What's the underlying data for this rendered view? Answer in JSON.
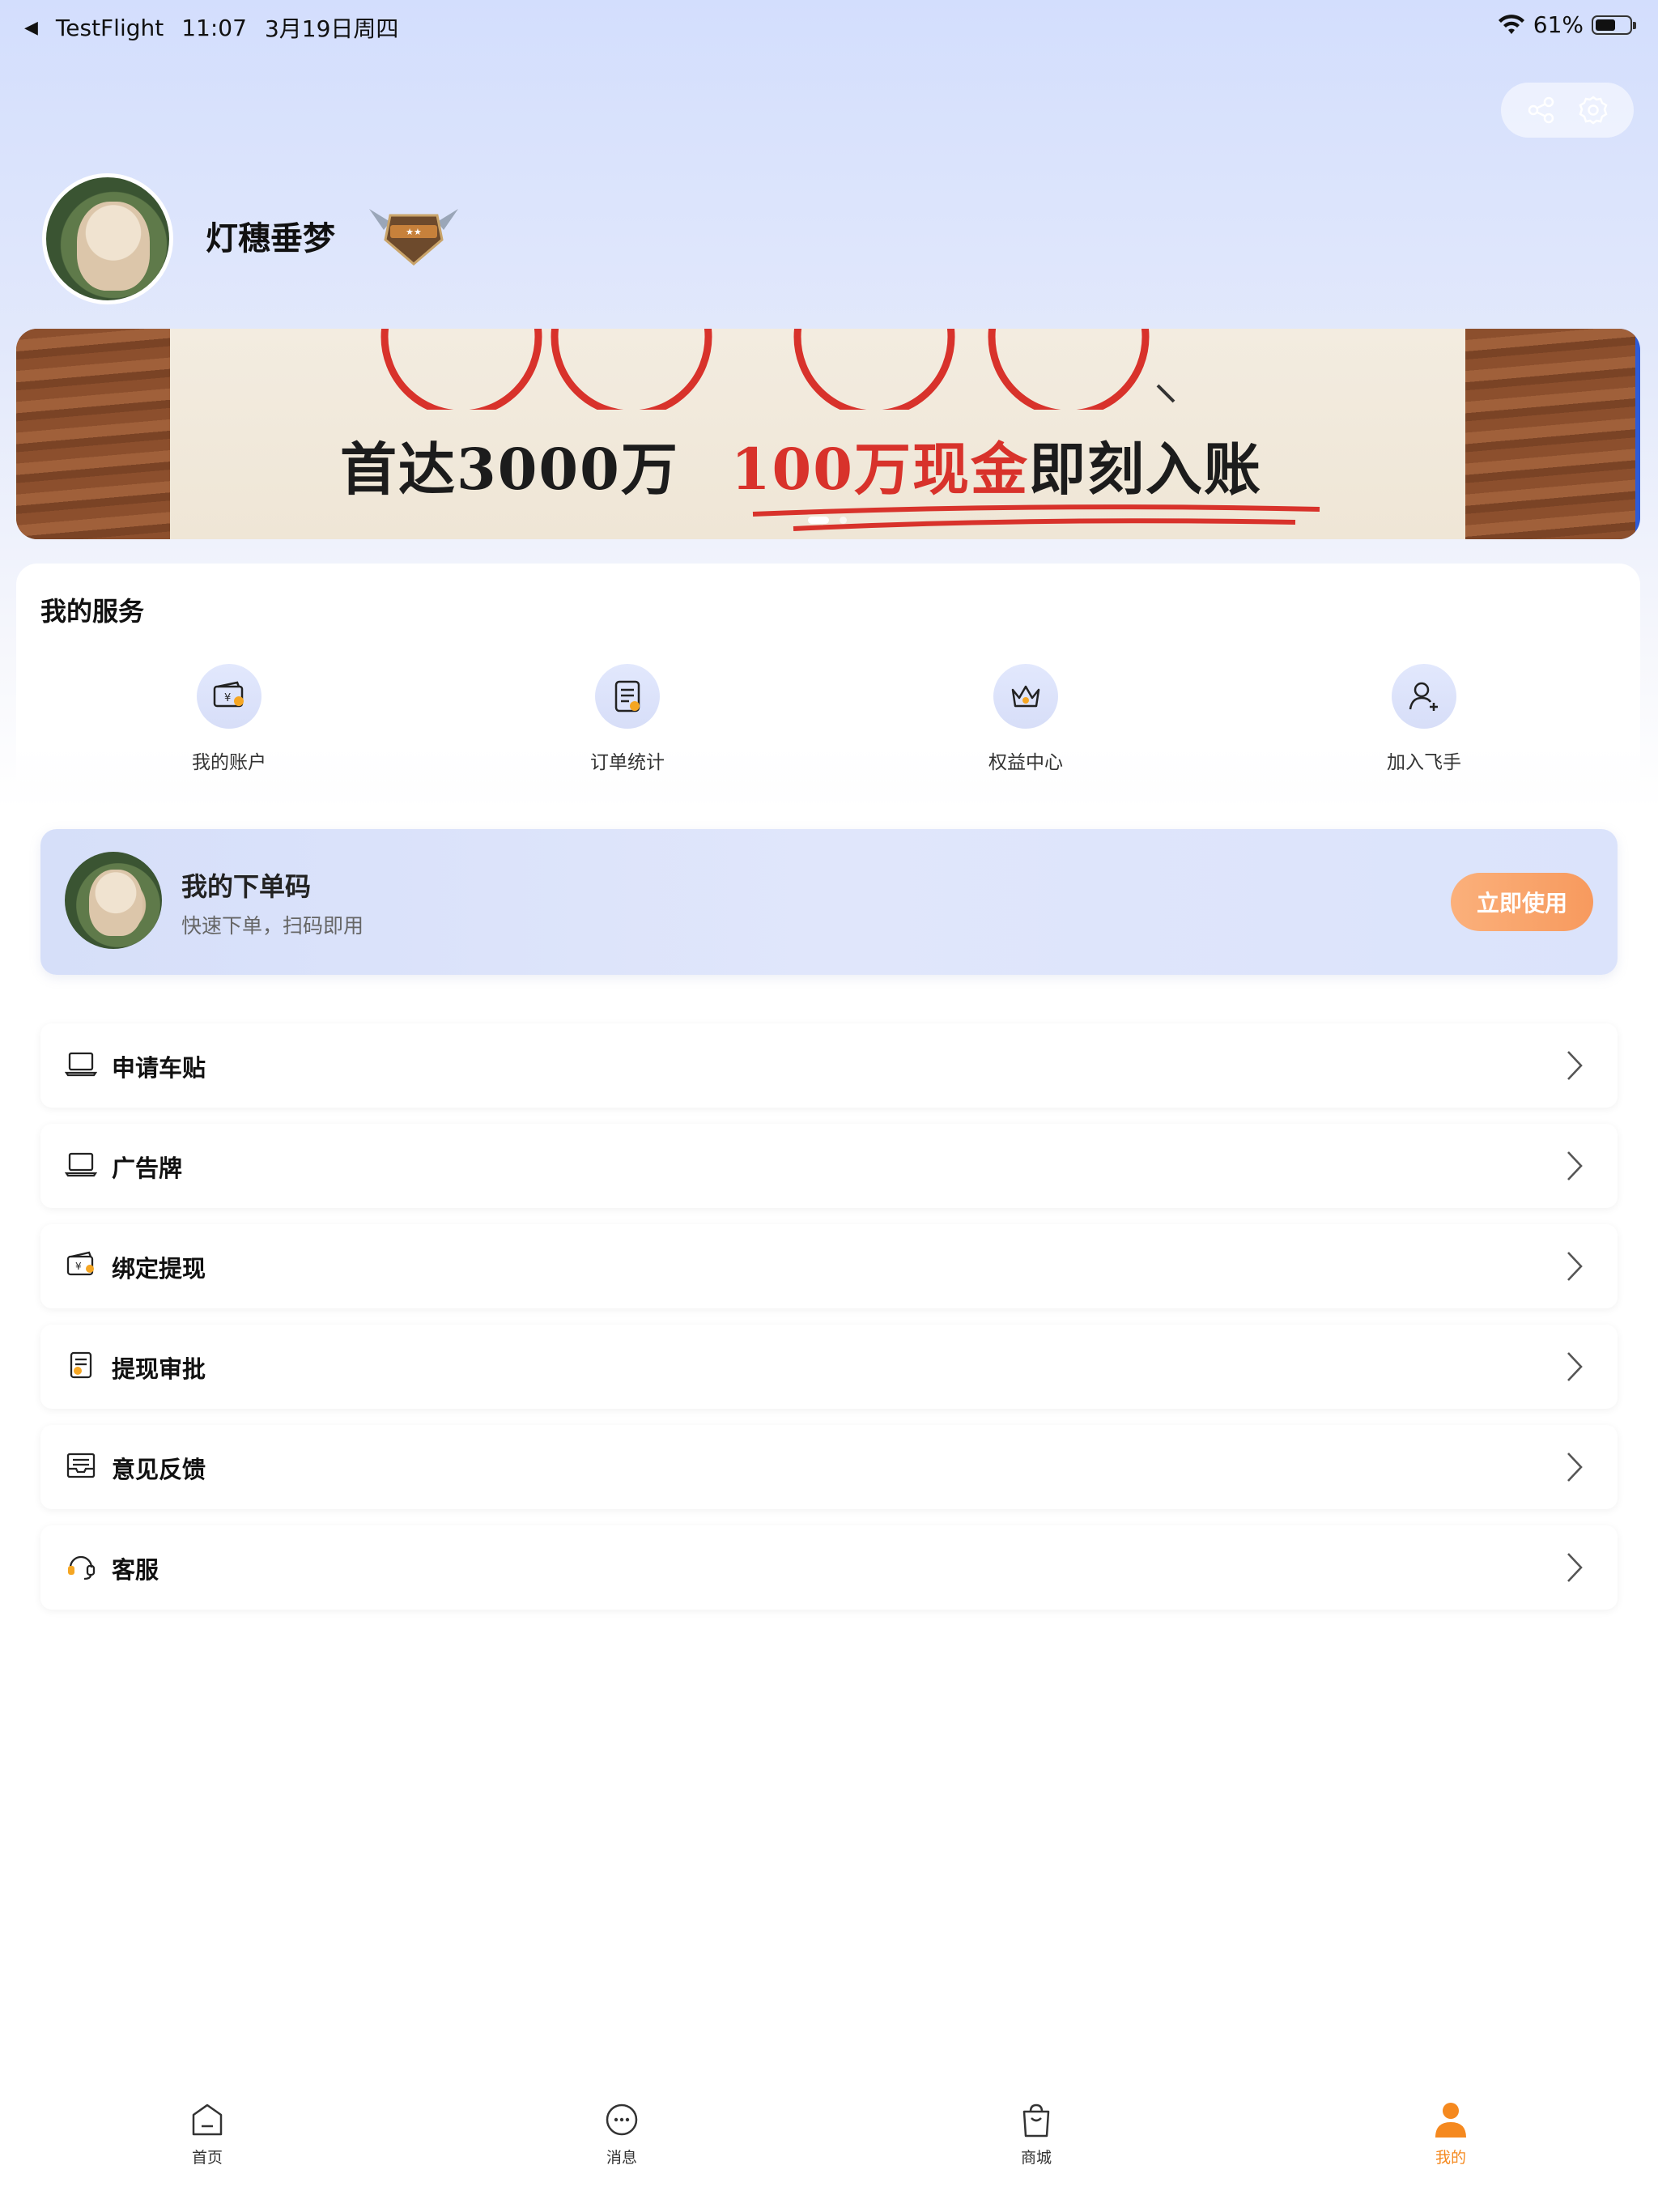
{
  "status_bar": {
    "back_app": "TestFlight",
    "time": "11:07",
    "date": "3月19日周四",
    "battery": "61%",
    "battery_level": 0.61
  },
  "profile": {
    "username": "灯穗垂梦",
    "badge_icon": "rank-badge-icon"
  },
  "banner": {
    "text_main": "首达3000万",
    "text_highlight": "100万现金",
    "text_tail": "即刻入账",
    "page_count": 2,
    "current_page": 1
  },
  "services": {
    "title": "我的服务",
    "items": [
      {
        "label": "我的账户",
        "icon": "wallet-icon"
      },
      {
        "label": "订单统计",
        "icon": "order-list-icon"
      },
      {
        "label": "权益中心",
        "icon": "crown-icon"
      },
      {
        "label": "加入飞手",
        "icon": "add-user-icon"
      }
    ]
  },
  "order_code": {
    "title": "我的下单码",
    "subtitle": "快速下单，扫码即用",
    "button": "立即使用"
  },
  "menu": [
    {
      "label": "申请车贴",
      "icon": "laptop-icon"
    },
    {
      "label": "广告牌",
      "icon": "laptop-icon"
    },
    {
      "label": "绑定提现",
      "icon": "wallet-icon"
    },
    {
      "label": "提现审批",
      "icon": "document-icon"
    },
    {
      "label": "意见反馈",
      "icon": "inbox-icon"
    },
    {
      "label": "客服",
      "icon": "headset-icon"
    }
  ],
  "tabbar": [
    {
      "label": "首页",
      "icon": "home-icon",
      "active": false
    },
    {
      "label": "消息",
      "icon": "message-icon",
      "active": false
    },
    {
      "label": "商城",
      "icon": "shopping-bag-icon",
      "active": false
    },
    {
      "label": "我的",
      "icon": "person-icon",
      "active": true
    }
  ],
  "colors": {
    "accent": "#f5891f",
    "button_gradient_start": "#fbb07b",
    "button_gradient_end": "#f79a5e",
    "header_bg": "#d3defd"
  }
}
